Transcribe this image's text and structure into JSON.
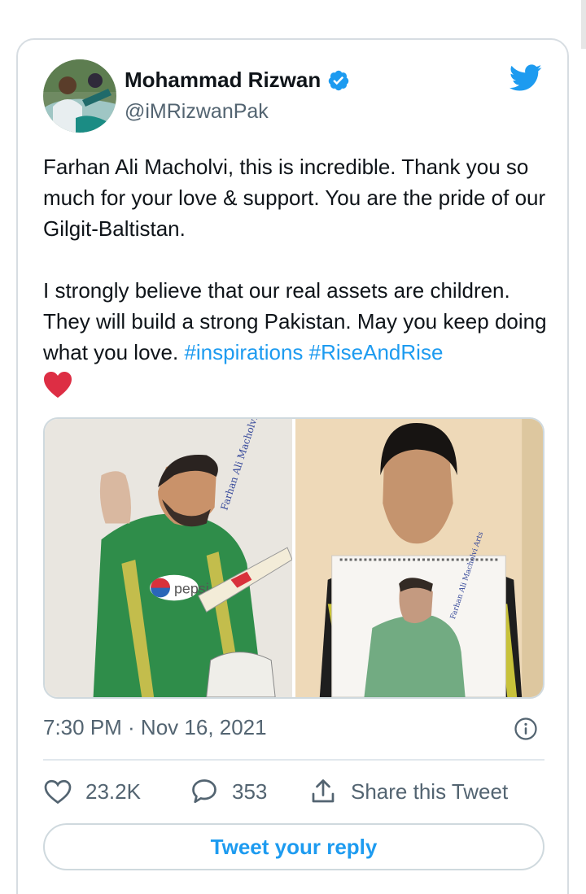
{
  "tweet": {
    "author": {
      "display_name": "Mohammad Rizwan",
      "handle": "@iMRizwanPak",
      "verified": true
    },
    "text_para1": "Farhan Ali Macholvi, this is incredible. Thank you so much for your love & support. You are the pride of our Gilgit-Baltistan.",
    "text_para2_plain": "I strongly believe that our real assets are children. They will build a strong Pakistan. May you keep doing what you love. ",
    "hashtags": [
      "#inspirations",
      "#RiseAndRise"
    ],
    "emoji": "red-heart",
    "media": [
      {
        "kind": "image",
        "alt_subject": "pencil sketch of cricketer in green jersey with bat",
        "signature_text": "Farhan Ali Macholvi Arts",
        "jersey_text": "pepsi"
      },
      {
        "kind": "image",
        "alt_subject": "boy holding sketchbook with drawing",
        "signature_text": "Farhan Ali Macholvi Arts"
      }
    ],
    "timestamp": "7:30 PM · Nov 16, 2021",
    "likes": "23.2K",
    "replies": "353",
    "share_label": "Share this Tweet",
    "reply_button_label": "Tweet your reply"
  },
  "icons": {
    "verified": "verified-badge-icon",
    "brand": "twitter-bird-icon",
    "info": "info-icon",
    "like": "heart-outline-icon",
    "reply": "speech-bubble-icon",
    "share": "share-upload-icon"
  },
  "colors": {
    "brand_blue": "#1d9bf0",
    "text_primary": "#0f1419",
    "text_secondary": "#536471",
    "border": "#cfd9de",
    "heart_red": "#e0245e"
  }
}
